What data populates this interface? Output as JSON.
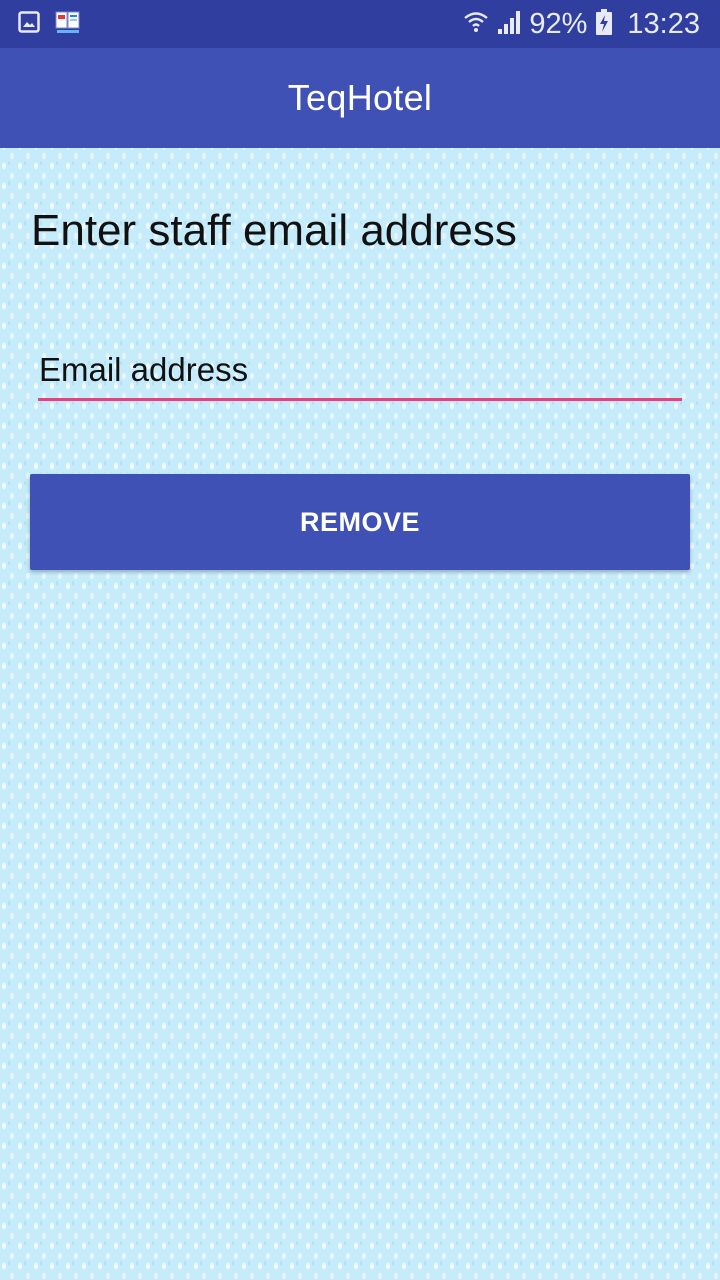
{
  "status_bar": {
    "battery": "92%",
    "time": "13:23",
    "icons": [
      "gallery-icon",
      "app-notification-icon",
      "wifi-icon",
      "signal-icon",
      "battery-charging-icon"
    ],
    "background": "#303f9f"
  },
  "app_bar": {
    "title": "TeqHotel",
    "background": "#3f51b5"
  },
  "main": {
    "heading": "Enter staff email address",
    "email_field": {
      "placeholder": "Email address",
      "value": "",
      "underline_color": "#ee3f7a"
    },
    "remove_button": {
      "label": "REMOVE",
      "background": "#3f51b5"
    }
  }
}
